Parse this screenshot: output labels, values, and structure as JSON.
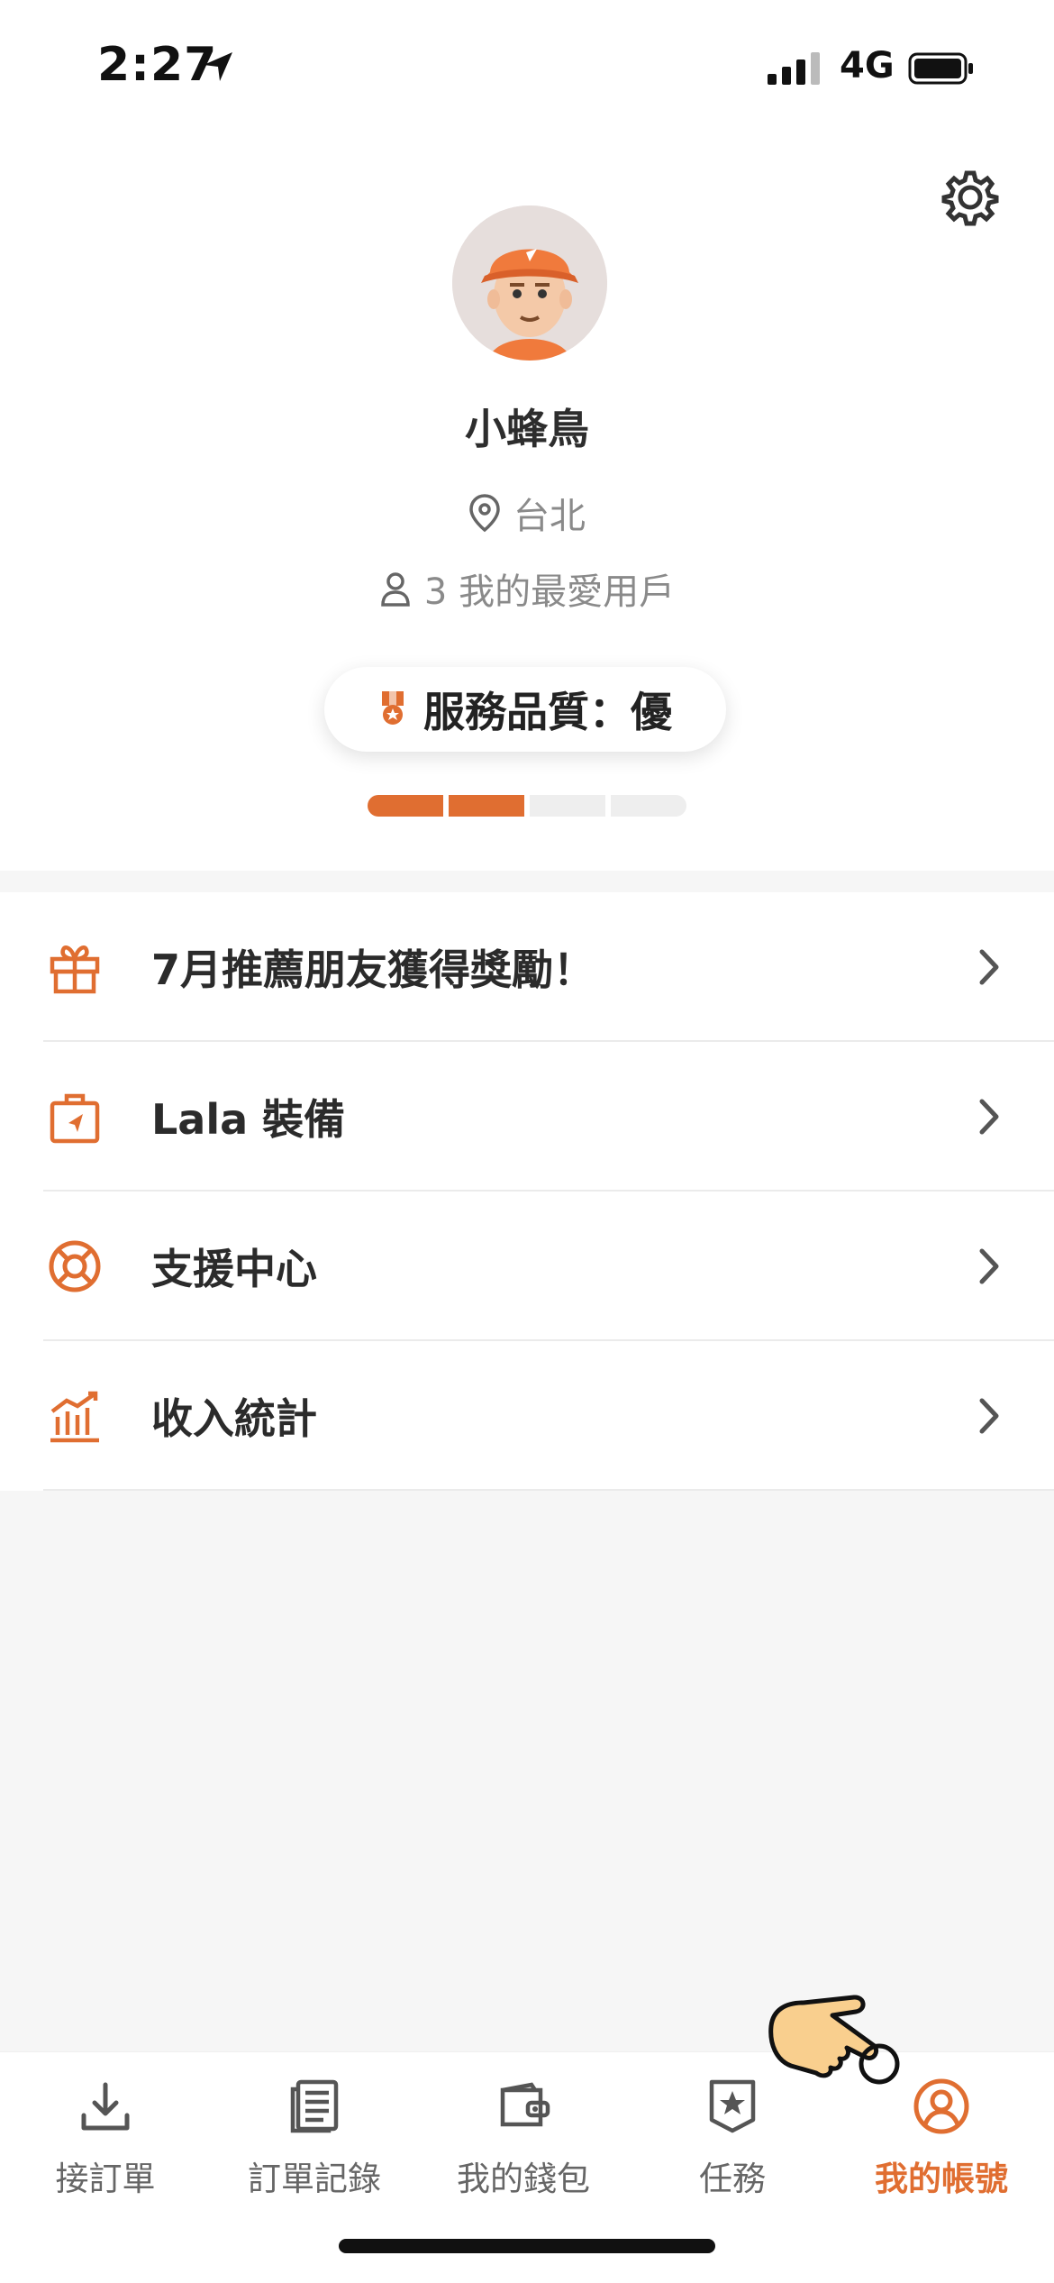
{
  "status_bar": {
    "time": "2:27",
    "network": "4G"
  },
  "profile": {
    "name": "小蜂鳥",
    "city": "台北",
    "favorite_users": "3 我的最愛用戶",
    "quality_label": "服務品質：優",
    "quality_level": {
      "filled": 2,
      "total": 4
    }
  },
  "menu": [
    {
      "label": "7月推薦朋友獲得獎勵！",
      "icon": "gift-icon"
    },
    {
      "label": "Lala 裝備",
      "icon": "shopping-bag-icon"
    },
    {
      "label": "支援中心",
      "icon": "lifebuoy-icon"
    },
    {
      "label": "收入統計",
      "icon": "income-chart-icon"
    }
  ],
  "nav": [
    {
      "label": "接訂單",
      "icon": "download-icon"
    },
    {
      "label": "訂單記錄",
      "icon": "document-list-icon"
    },
    {
      "label": "我的錢包",
      "icon": "wallet-icon"
    },
    {
      "label": "任務",
      "icon": "star-badge-icon"
    },
    {
      "label": "我的帳號",
      "icon": "account-icon",
      "active": true
    }
  ],
  "colors": {
    "accent": "#e06e31",
    "text": "#2b2b2b",
    "muted": "#8a8a8a",
    "background_gray": "#f6f6f6"
  }
}
